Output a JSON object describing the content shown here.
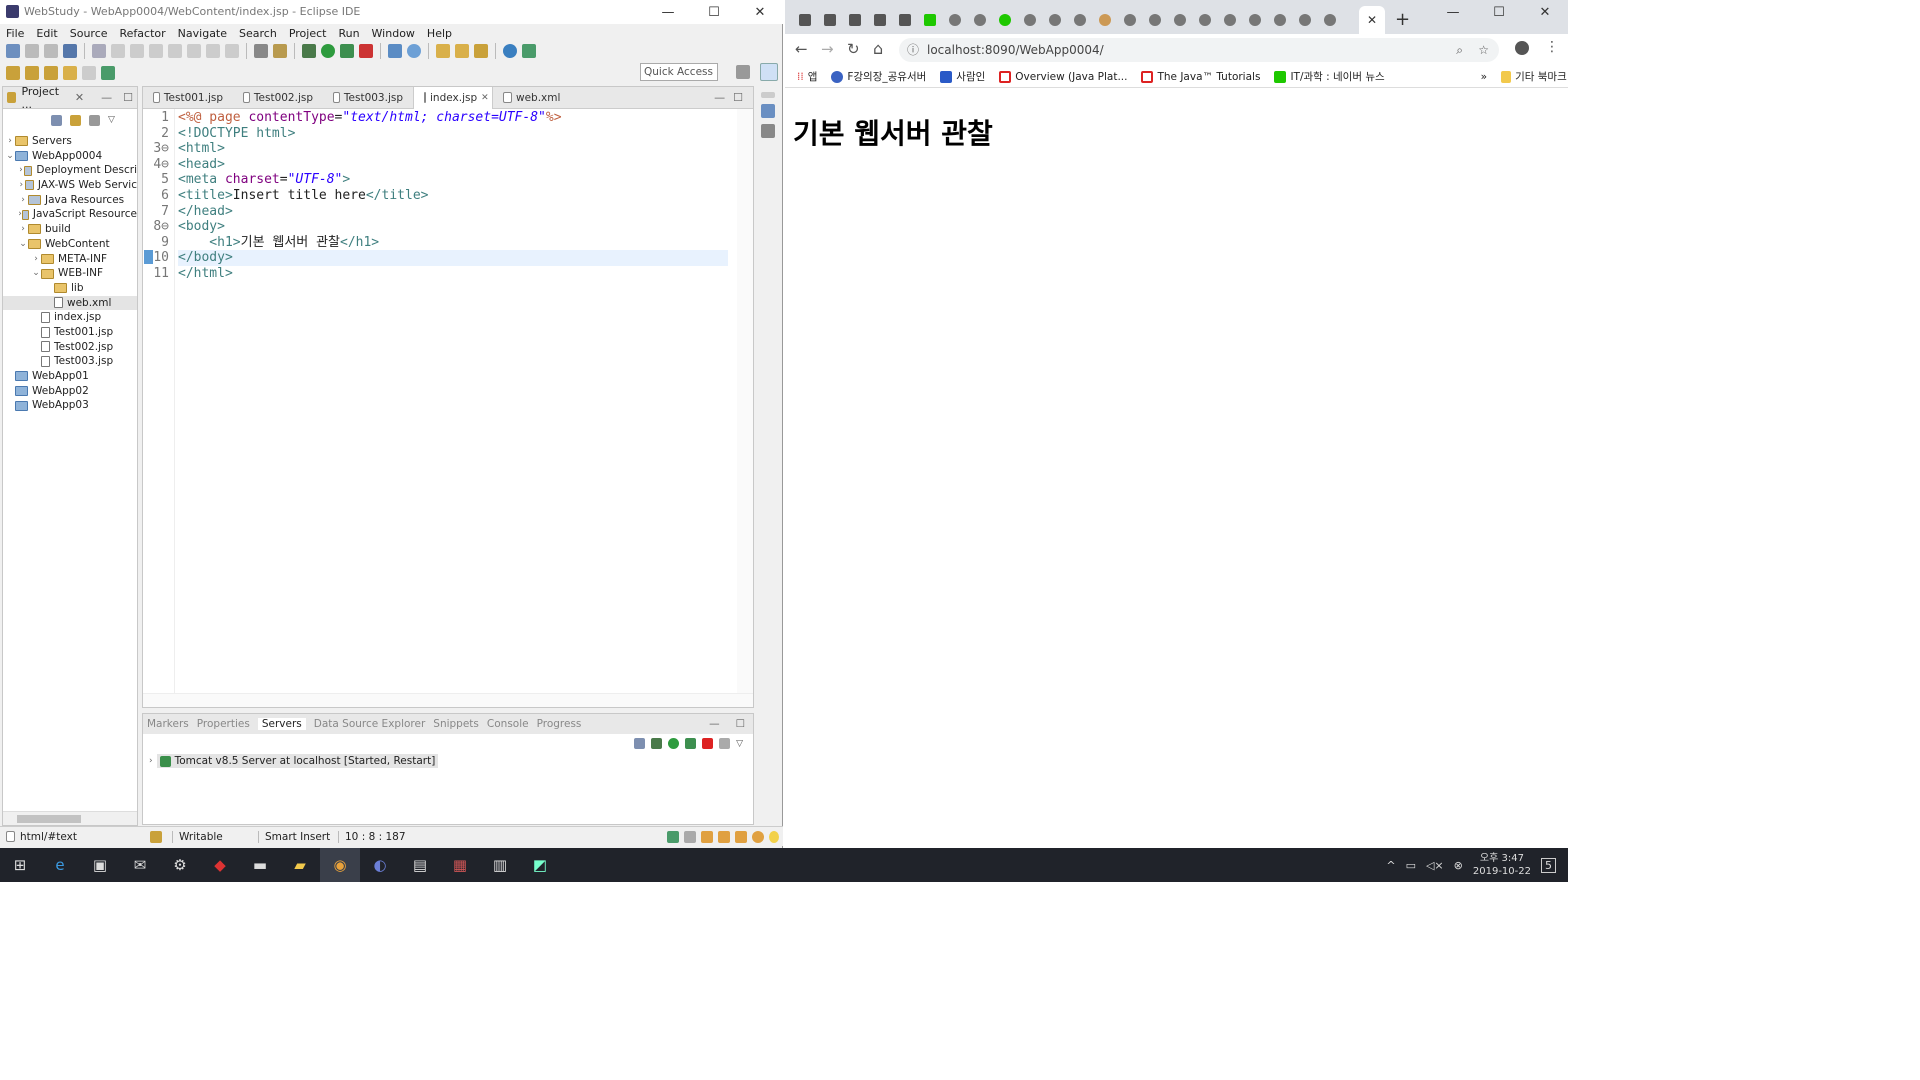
{
  "eclipse": {
    "title": "WebStudy - WebApp0004/WebContent/index.jsp - Eclipse IDE",
    "menu": [
      "File",
      "Edit",
      "Source",
      "Refactor",
      "Navigate",
      "Search",
      "Project",
      "Run",
      "Window",
      "Help"
    ],
    "quick_access": "Quick Access",
    "explorer": {
      "title": "Project ...",
      "items": [
        {
          "label": "Servers",
          "depth": 0,
          "chev": "›",
          "icon": "folder-icon"
        },
        {
          "label": "WebApp0004",
          "depth": 0,
          "chev": "⌄",
          "icon": "project-icon"
        },
        {
          "label": "Deployment Descri",
          "depth": 1,
          "chev": "›",
          "icon": "descriptor-icon"
        },
        {
          "label": "JAX-WS Web Servic",
          "depth": 1,
          "chev": "›",
          "icon": "webservice-icon"
        },
        {
          "label": "Java Resources",
          "depth": 1,
          "chev": "›",
          "icon": "java-icon"
        },
        {
          "label": "JavaScript Resource",
          "depth": 1,
          "chev": "›",
          "icon": "js-icon"
        },
        {
          "label": "build",
          "depth": 1,
          "chev": "›",
          "icon": "folder-icon"
        },
        {
          "label": "WebContent",
          "depth": 1,
          "chev": "⌄",
          "icon": "folder-icon"
        },
        {
          "label": "META-INF",
          "depth": 2,
          "chev": "›",
          "icon": "folder-icon"
        },
        {
          "label": "WEB-INF",
          "depth": 2,
          "chev": "⌄",
          "icon": "folder-icon"
        },
        {
          "label": "lib",
          "depth": 3,
          "chev": "",
          "icon": "folder-icon"
        },
        {
          "label": "web.xml",
          "depth": 3,
          "chev": "",
          "icon": "xml-file-icon"
        },
        {
          "label": "index.jsp",
          "depth": 2,
          "chev": "",
          "icon": "file-icon"
        },
        {
          "label": "Test001.jsp",
          "depth": 2,
          "chev": "",
          "icon": "file-icon"
        },
        {
          "label": "Test002.jsp",
          "depth": 2,
          "chev": "",
          "icon": "file-icon"
        },
        {
          "label": "Test003.jsp",
          "depth": 2,
          "chev": "",
          "icon": "file-icon"
        },
        {
          "label": "WebApp01",
          "depth": 0,
          "chev": "",
          "icon": "project-icon"
        },
        {
          "label": "WebApp02",
          "depth": 0,
          "chev": "",
          "icon": "project-icon"
        },
        {
          "label": "WebApp03",
          "depth": 0,
          "chev": "",
          "icon": "project-icon"
        }
      ]
    },
    "editor_tabs": [
      "Test001.jsp",
      "Test002.jsp",
      "Test003.jsp",
      "index.jsp",
      "web.xml"
    ],
    "active_tab": "index.jsp",
    "line_numbers": [
      "1",
      "2",
      "3⊖",
      "4⊖",
      "5",
      "6",
      "7",
      "8⊖",
      "9",
      "10",
      "11"
    ],
    "code": {
      "l1a": "<%@ page ",
      "l1b": "contentType",
      "l1c": "=",
      "l1d": "\"text/html; charset=UTF-8\"",
      "l1e": "%>",
      "l2": "<!DOCTYPE html>",
      "l3": "<html>",
      "l4": "<head>",
      "l5a": "<meta ",
      "l5b": "charset",
      "l5c": "=",
      "l5d": "\"UTF-8\"",
      "l5e": ">",
      "l6a": "<title>",
      "l6b": "Insert title here",
      "l6c": "</title>",
      "l7": "</head>",
      "l8": "<body>",
      "l9a": "    <h1>",
      "l9b": "기본 웹서버 관찰",
      "l9c": "</h1>",
      "l10": "</body>",
      "l11": "</html>"
    },
    "bottom_tabs": [
      "Markers",
      "Properties",
      "Servers",
      "Data Source Explorer",
      "Snippets",
      "Console",
      "Progress"
    ],
    "server_entry": "Tomcat v8.5 Server at localhost  [Started, Restart]",
    "status": {
      "path": "html/#text",
      "writable": "Writable",
      "insert": "Smart Insert",
      "pos": "10 : 8 : 187"
    }
  },
  "chrome": {
    "url": "localhost:8090/WebApp0004/",
    "bookmarks": [
      "앱",
      "F강의장_공유서버",
      "사람인",
      "Overview (Java Plat...",
      "The Java™ Tutorials",
      "IT/과학 : 네이버 뉴스",
      "»",
      "기타 북마크"
    ],
    "page_heading": "기본 웹서버 관찰"
  },
  "taskbar": {
    "time": "오후 3:47",
    "date": "2019-10-22",
    "notif": "5"
  },
  "colors": {
    "tag": "#3f7f7f",
    "attr": "#7f007f",
    "value": "#2a00ff",
    "jsp": "#bf5f3f",
    "taskbar": "#20232a"
  }
}
